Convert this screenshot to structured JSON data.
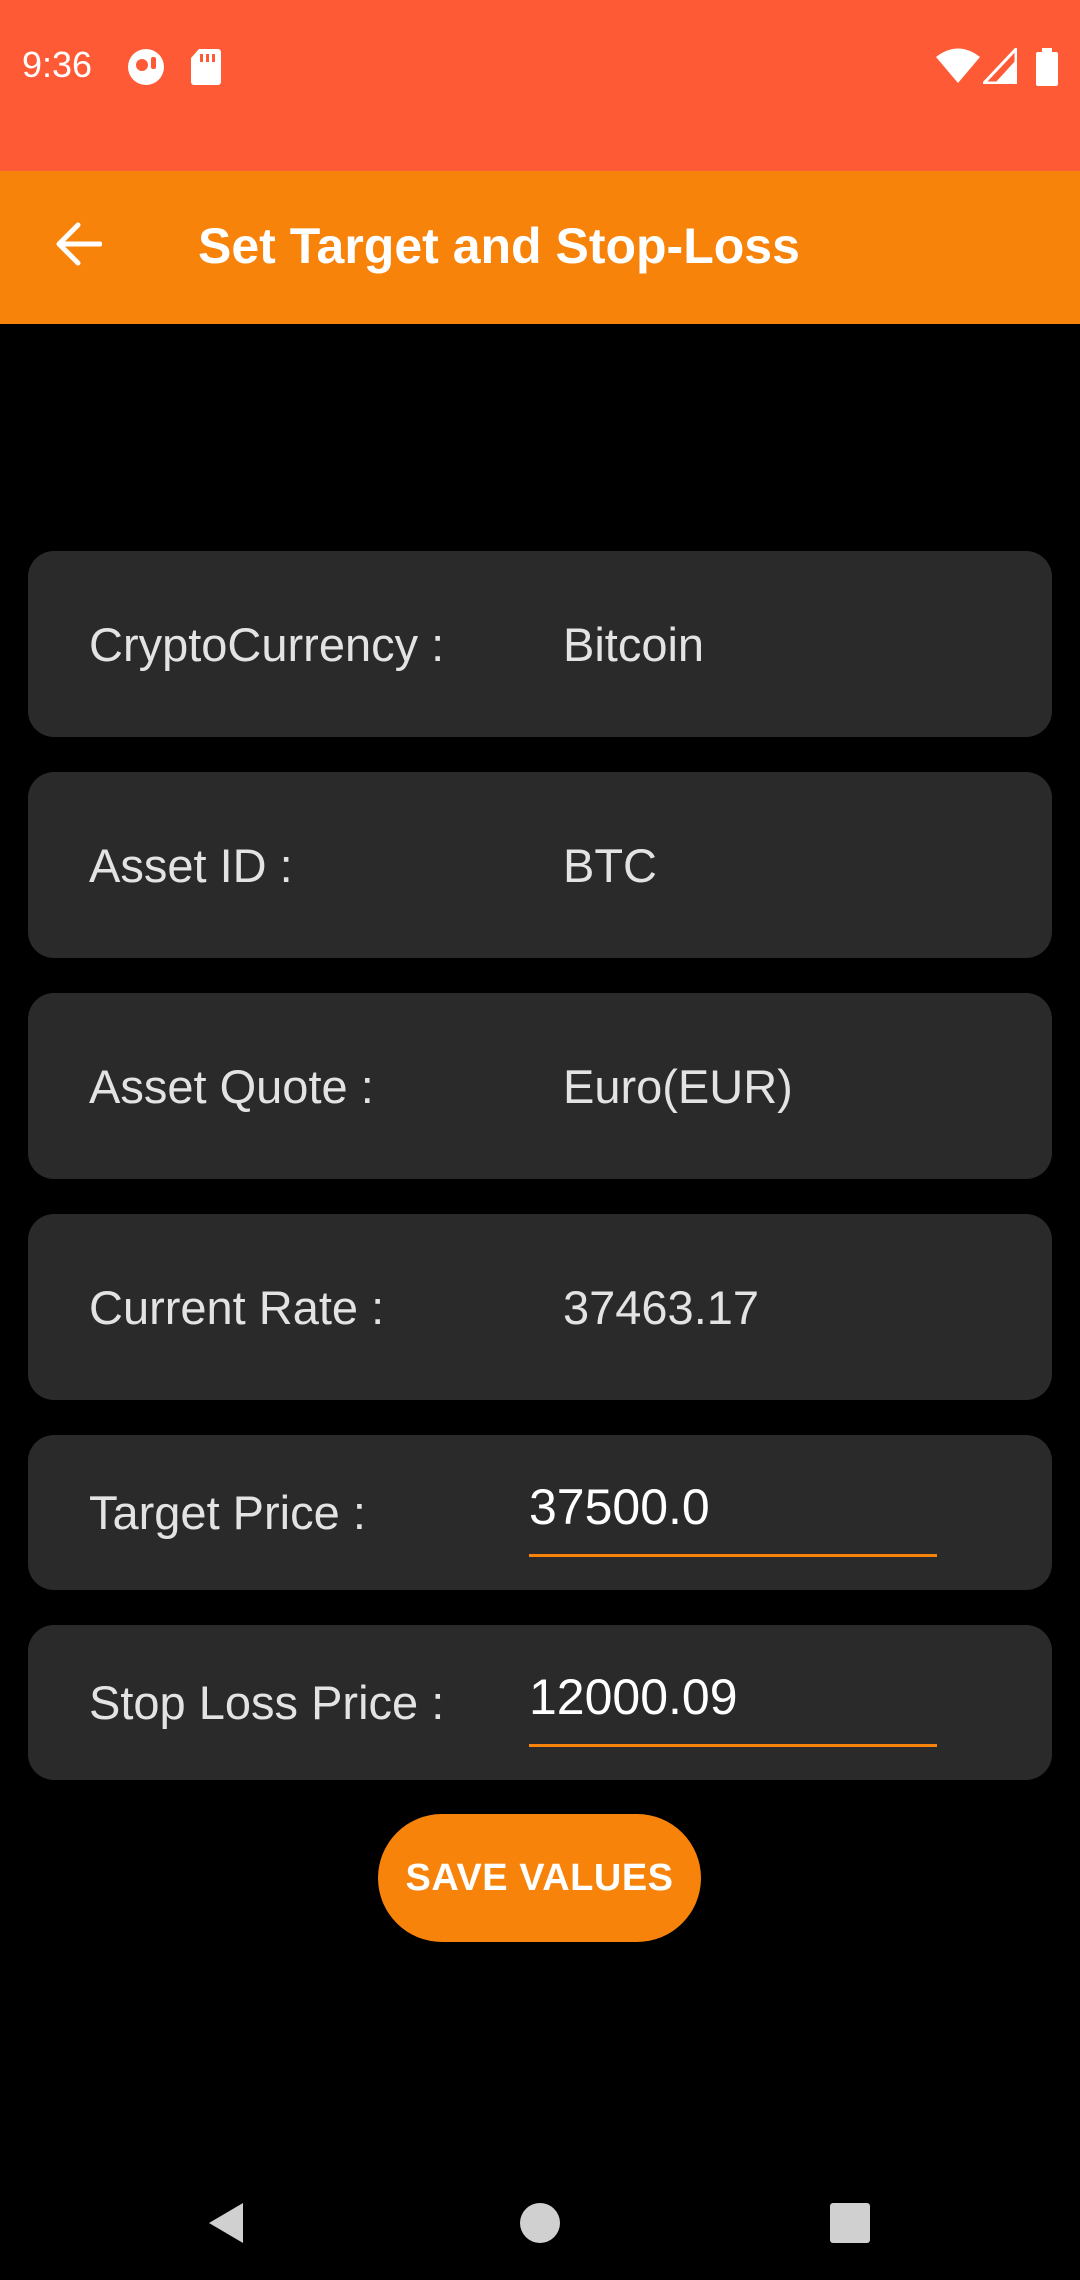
{
  "status_bar": {
    "time": "9:36",
    "background": "#FF5A36",
    "left_icons": [
      "notification-icon",
      "sd-card-icon"
    ],
    "right_icons": [
      "wifi-icon",
      "cell-signal-icon",
      "battery-icon"
    ]
  },
  "app_bar": {
    "title": "Set Target and Stop-Loss",
    "background": "#F7830B",
    "back_icon": "arrow-back-icon"
  },
  "rows": [
    {
      "label": "CryptoCurrency :",
      "value": "Bitcoin"
    },
    {
      "label": "Asset ID :",
      "value": "BTC"
    },
    {
      "label": "Asset Quote :",
      "value": "Euro(EUR)"
    },
    {
      "label": "Current Rate :",
      "value": "37463.17"
    }
  ],
  "target_price": {
    "label": "Target Price :",
    "value": "37500.0"
  },
  "stop_loss": {
    "label": "Stop Loss Price :",
    "value": "12000.09"
  },
  "save_button": {
    "label": "SAVE VALUES"
  },
  "colors": {
    "accent": "#F7830B",
    "status_bar": "#FF5A36",
    "card": "#2A2A2A",
    "background": "#000000"
  },
  "nav_bar": {
    "icons": [
      "back-triangle-icon",
      "home-circle-icon",
      "recents-square-icon"
    ]
  }
}
